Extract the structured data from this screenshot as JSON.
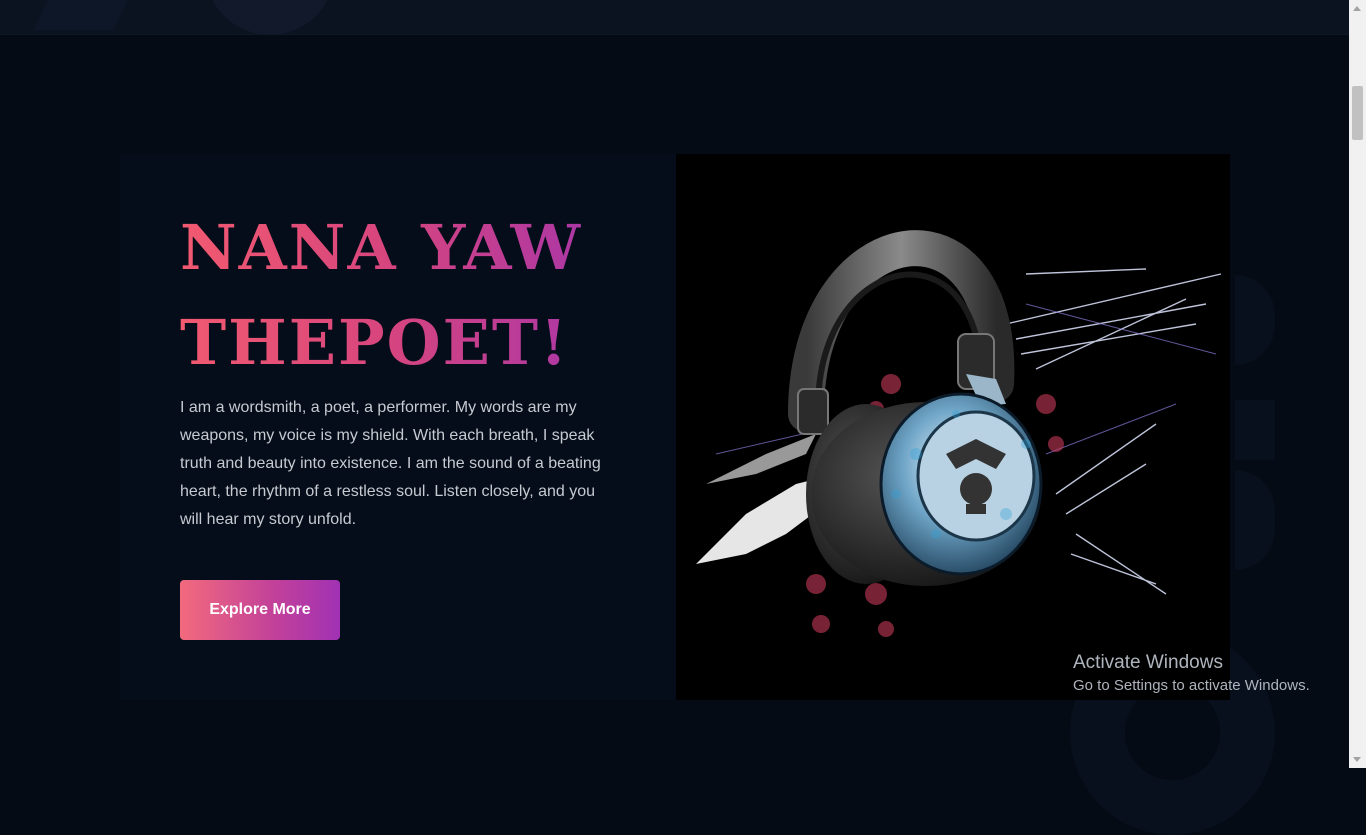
{
  "hero": {
    "title": "NANA YAW THEPOET!",
    "description": "I am a wordsmith, a poet, a performer. My words are my weapons, my voice is my shield. With each breath, I speak truth and beauty into existence. I am the sound of a beating heart, the rhythm of a restless soul. Listen closely, and you will hear my story unfold.",
    "cta_label": "Explore More",
    "image_icon": "headphones-image"
  },
  "watermark": {
    "title": "Activate Windows",
    "subtitle": "Go to Settings to activate Windows."
  },
  "colors": {
    "background": "#050b14",
    "gradient_start": "#f26a7d",
    "gradient_end": "#a132b4"
  }
}
